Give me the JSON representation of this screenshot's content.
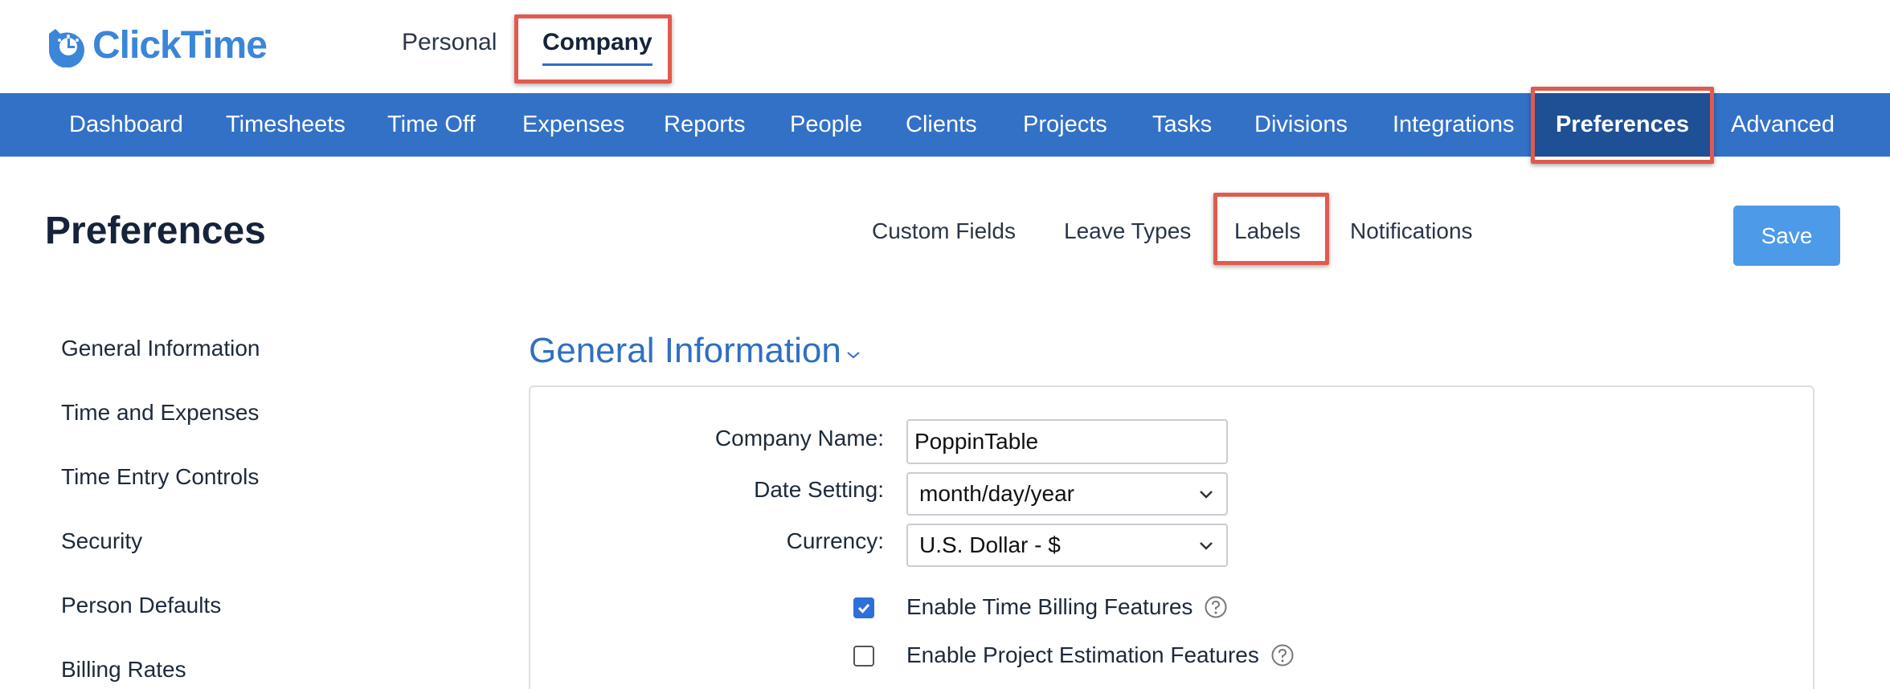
{
  "app": {
    "logo_text": "ClickTime"
  },
  "scope_tabs": {
    "personal": "Personal",
    "company": "Company"
  },
  "nav": {
    "items": [
      "Dashboard",
      "Timesheets",
      "Time Off",
      "Expenses",
      "Reports",
      "People",
      "Clients",
      "Projects",
      "Tasks",
      "Divisions",
      "Integrations",
      "Preferences",
      "Advanced"
    ],
    "active": "Preferences"
  },
  "page": {
    "title": "Preferences",
    "save_label": "Save"
  },
  "subtabs": [
    "Custom Fields",
    "Leave Types",
    "Labels",
    "Notifications"
  ],
  "sidebar": [
    "General Information",
    "Time and Expenses",
    "Time Entry Controls",
    "Security",
    "Person Defaults",
    "Billing Rates"
  ],
  "section": {
    "title": "General Information",
    "company_name_label": "Company Name:",
    "company_name_value": "PoppinTable",
    "date_setting_label": "Date Setting:",
    "date_setting_value": "month/day/year",
    "currency_label": "Currency:",
    "currency_value": "U.S. Dollar - $",
    "billing_label": "Enable Time Billing Features",
    "billing_checked": true,
    "estimation_label": "Enable Project Estimation Features",
    "estimation_checked": false
  },
  "colors": {
    "nav_bg": "#3371c7",
    "nav_active": "#1f4f95",
    "highlight": "#e05a4e",
    "save_button": "#4d9ae8",
    "accent": "#2f6fc3"
  }
}
